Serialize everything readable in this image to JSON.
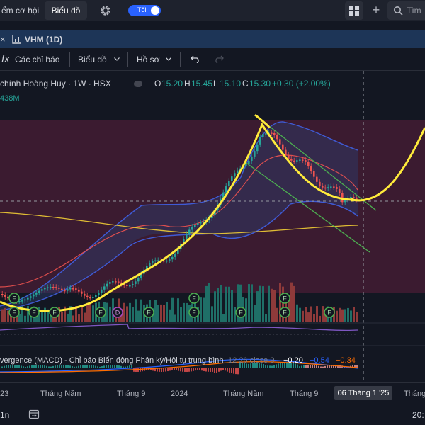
{
  "topbar": {
    "screener_label": "ểm cơ hội",
    "chart_tab_label": "Biểu đồ",
    "theme_toggle_label": "Tối",
    "search_placeholder": "Tìm",
    "icons": [
      "gear-icon",
      "grid-icon",
      "plus-icon",
      "search-icon"
    ]
  },
  "chart_tab": {
    "close_symbol": "×",
    "title": "VHM (1D)"
  },
  "toolbar": {
    "fx_symbol": "fx",
    "indicators_label": "Các chỉ báo",
    "chart_type_label": "Biểu đồ",
    "profile_label": "Hồ sơ"
  },
  "legend": {
    "symbol_name": "chính Hoàng Huy · 1W · HSX",
    "open_key": "O",
    "open_value": "15.20",
    "high_key": "H",
    "high_value": "15.45",
    "low_key": "L",
    "low_value": "15.10",
    "close_key": "C",
    "close_value": "15.30",
    "change": "+0.30 (+2.00%)",
    "volume": "438M"
  },
  "event_markers": [
    {
      "label": "F"
    },
    {
      "label": "F"
    },
    {
      "label": "F"
    },
    {
      "label": "F"
    },
    {
      "label": "F"
    },
    {
      "label": "F"
    },
    {
      "label": "D"
    },
    {
      "label": "F"
    },
    {
      "label": "F"
    },
    {
      "label": "F"
    },
    {
      "label": "F"
    },
    {
      "label": "F"
    },
    {
      "label": "F"
    }
  ],
  "macd": {
    "label": "vergence (MACD) - Chỉ báo Biến động Phân kỳ/Hội tụ trung bình",
    "params": "12 26 close 9",
    "value_histogram": "−0.20",
    "value_macd": "−0.54",
    "value_signal": "−0.34"
  },
  "time_axis": {
    "ticks": [
      {
        "label": "23",
        "bold": true
      },
      {
        "label": "Tháng Năm",
        "bold": false
      },
      {
        "label": "Tháng 9",
        "bold": false
      },
      {
        "label": "2024",
        "bold": true
      },
      {
        "label": "Tháng Năm",
        "bold": false
      },
      {
        "label": "Tháng 9",
        "bold": false
      },
      {
        "label": "Tháng",
        "bold": false
      }
    ],
    "cursor_date": "06 Tháng 1 '25"
  },
  "bottombar": {
    "interval": "1n",
    "clock": "20:"
  },
  "colors": {
    "up": "#26a69a",
    "down": "#ef5350",
    "pattern": "#ffeb3b",
    "accent": "#2962ff"
  }
}
